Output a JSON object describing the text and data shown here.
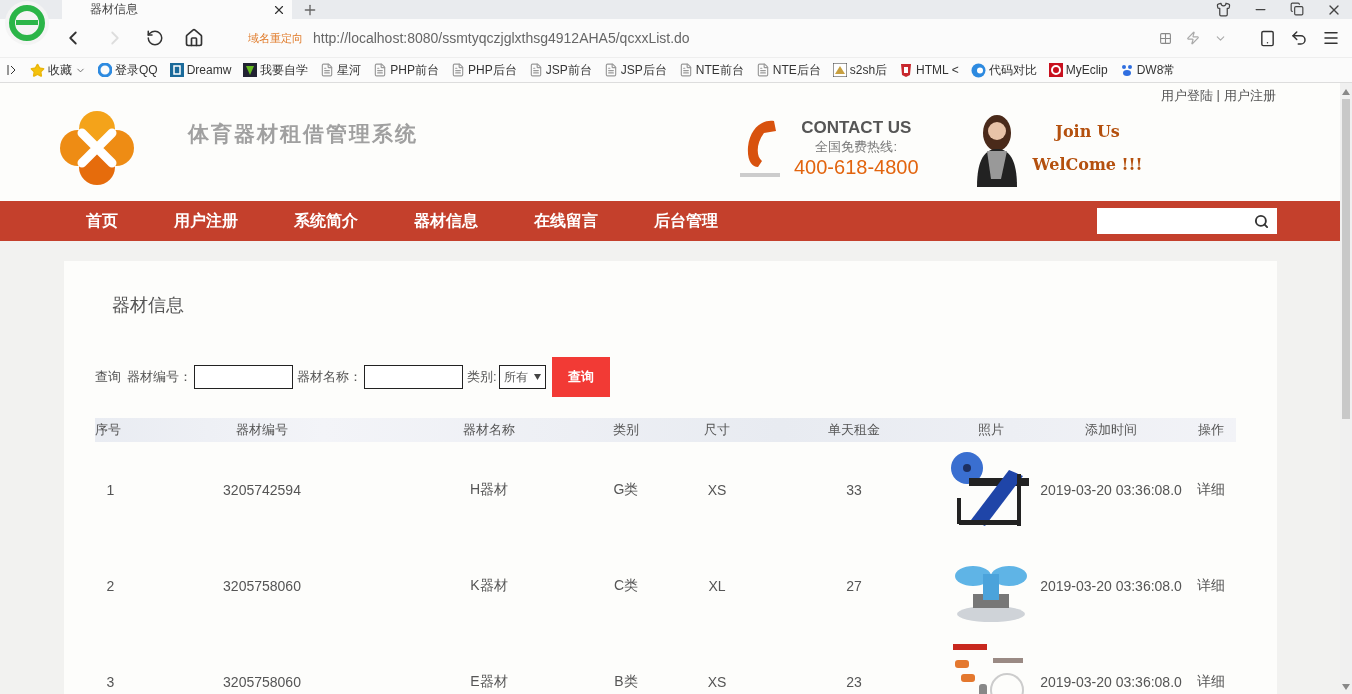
{
  "browser": {
    "tab": {
      "title": "器材信息",
      "selected": true
    },
    "redirect_label": "域名重定向",
    "url": "http://localhost:8080/ssmtyqczjglxthsg4912AHA5/qcxxList.do",
    "bookmarks": [
      {
        "label": "收藏",
        "kind": "star"
      },
      {
        "label": "登录QQ",
        "kind": "qq"
      },
      {
        "label": "Dreamw",
        "kind": "dw"
      },
      {
        "label": "我要自学",
        "kind": "leaf"
      },
      {
        "label": "星河",
        "kind": "page"
      },
      {
        "label": "PHP前台",
        "kind": "page"
      },
      {
        "label": "PHP后台",
        "kind": "page"
      },
      {
        "label": "JSP前台",
        "kind": "page"
      },
      {
        "label": "JSP后台",
        "kind": "page"
      },
      {
        "label": "NTE前台",
        "kind": "page"
      },
      {
        "label": "NTE后台",
        "kind": "page"
      },
      {
        "label": "s2sh后",
        "kind": "tiger"
      },
      {
        "label": "HTML <",
        "kind": "html"
      },
      {
        "label": "代码对比",
        "kind": "cblue"
      },
      {
        "label": "MyEclip",
        "kind": "cred"
      },
      {
        "label": "DW8常",
        "kind": "paw"
      }
    ]
  },
  "page": {
    "top_links": [
      "用户登陆",
      "用户注册"
    ],
    "top_separator": "|",
    "site_title": "体育器材租借管理系统",
    "contact": {
      "heading": "CONTACT US",
      "subtitle": "全国免费热线:",
      "phone": "400-618-4800"
    },
    "join": {
      "line_1": "Join Us",
      "line_2": "WelCome !!!"
    },
    "nav": [
      {
        "label": "首页"
      },
      {
        "label": "用户注册"
      },
      {
        "label": "系统简介"
      },
      {
        "label": "器材信息"
      },
      {
        "label": "在线留言"
      },
      {
        "label": "后台管理"
      }
    ],
    "panel": {
      "title": "器材信息",
      "filter": {
        "label": "查询",
        "fields": [
          {
            "label": "器材编号："
          },
          {
            "label": "器材名称："
          }
        ],
        "select": {
          "label": "类别:",
          "value": "所有"
        },
        "button": "查询"
      },
      "table": {
        "columns": [
          "序号",
          "器材编号",
          "器材名称",
          "类别",
          "尺寸",
          "单天租金",
          "照片",
          "添加时间",
          "操作"
        ],
        "rows": [
          {
            "no": "1",
            "code": "3205742594",
            "name": "H器材",
            "category": "G类",
            "size": "XS",
            "rent": "33",
            "added": "2019-03-20 03:36:08.0",
            "action": "详细"
          },
          {
            "no": "2",
            "code": "3205758060",
            "name": "K器材",
            "category": "C类",
            "size": "XL",
            "rent": "27",
            "added": "2019-03-20 03:36:08.0",
            "action": "详细"
          },
          {
            "no": "3",
            "code": "3205758060",
            "name": "E器材",
            "category": "B类",
            "size": "XS",
            "rent": "23",
            "added": "2019-03-20 03:36:08.0",
            "action": "详细"
          }
        ]
      }
    }
  }
}
